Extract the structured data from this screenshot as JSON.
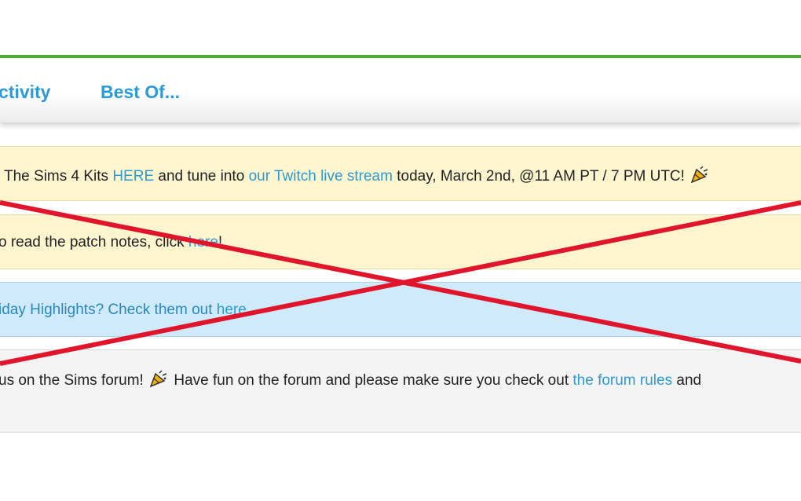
{
  "nav": {
    "activity_label": "ctivity",
    "bestof_label": "Best Of..."
  },
  "banner1": {
    "t1": "The Sims 4 Kits ",
    "link1": "HERE",
    "t2": " and tune into ",
    "link2": "our Twitch live stream",
    "t3": " today, March 2nd, @11 AM PT / 7 PM UTC! "
  },
  "banner2": {
    "t1": "o read the patch notes, click ",
    "link1": "here",
    "t2": "!"
  },
  "banner3": {
    "t1": "iday Highlights? Check them out ",
    "link1": "here",
    "t2": "."
  },
  "banner4": {
    "t1": "us on the Sims forum! ",
    "t2": " Have fun on the forum and please make sure you check out ",
    "link1": "the forum rules",
    "t3": " and"
  },
  "icons": {
    "party": "party-popper-icon"
  },
  "colors": {
    "accent": "#2b9ad6",
    "green_bar": "#4caf32",
    "cross": "#e0152c"
  }
}
